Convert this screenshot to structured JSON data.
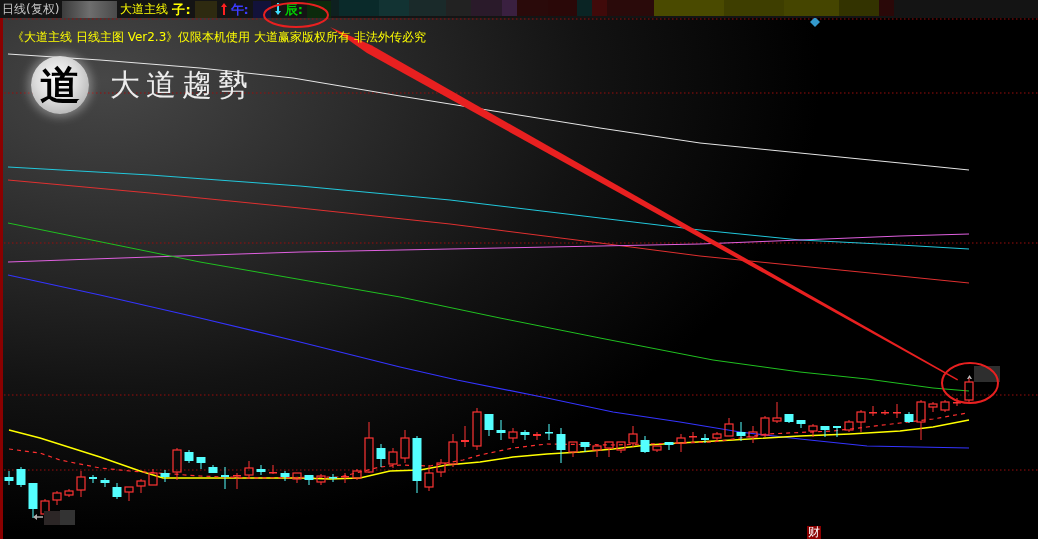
{
  "toolbar": {
    "period": "日线(复权)",
    "indicator": "大道主线",
    "fields": [
      {
        "label": "子:",
        "kind": "plain",
        "color": "#ffff00"
      },
      {
        "label": "午:",
        "kind": "up",
        "color": "#3c3cff"
      },
      {
        "label": "辰:",
        "kind": "down",
        "color": "#00d000"
      }
    ]
  },
  "chart": {
    "notice": "《大道主线 日线主图 Ver2.3》仅限本机使用 大道赢家版权所有 非法外传必究",
    "logo": {
      "emblem": "道",
      "name": "大道趨勢"
    },
    "marker": "财"
  }
}
